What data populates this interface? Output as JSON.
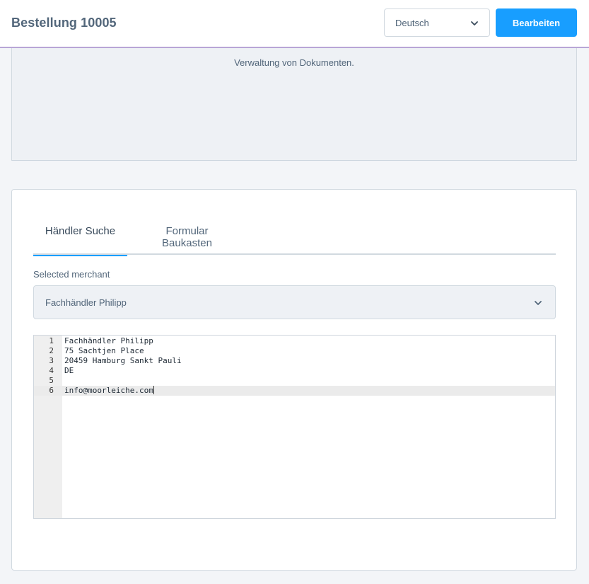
{
  "header": {
    "title": "Bestellung 10005",
    "language": {
      "selected": "Deutsch",
      "icon": "chevron-down-icon"
    },
    "edit_label": "Bearbeiten"
  },
  "documents": {
    "description": "Verwaltung von Dokumenten."
  },
  "tabs": [
    {
      "label": "Händler Suche",
      "active": true
    },
    {
      "label": "Formular Baukasten",
      "active": false
    }
  ],
  "merchant": {
    "label": "Selected merchant",
    "selected": "Fachhändler Philipp",
    "icon": "chevron-down-icon"
  },
  "editor": {
    "lines": [
      {
        "number": "1",
        "text": "Fachhändler Philipp"
      },
      {
        "number": "2",
        "text": "75 Sachtjen Place"
      },
      {
        "number": "3",
        "text": "20459 Hamburg Sankt Pauli"
      },
      {
        "number": "4",
        "text": "DE"
      },
      {
        "number": "5",
        "text": ""
      },
      {
        "number": "6",
        "text": "info@moorleiche.com"
      }
    ],
    "active_line": 6
  },
  "colors": {
    "primary": "#189eff",
    "header_border": "#b8a6d6",
    "text": "#52667a"
  }
}
